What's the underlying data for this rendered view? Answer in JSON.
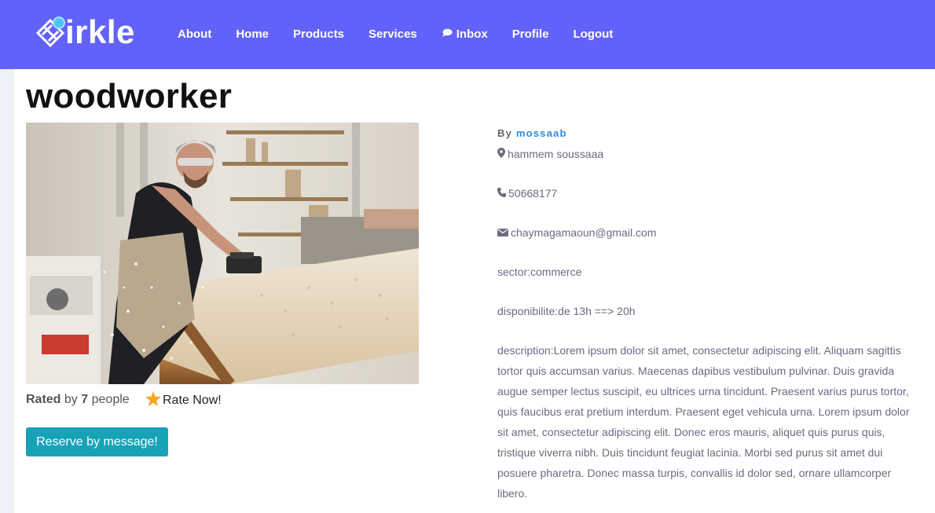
{
  "brand": {
    "name": "irkle"
  },
  "nav": {
    "items": [
      {
        "label": "About",
        "icon": ""
      },
      {
        "label": "Home",
        "icon": ""
      },
      {
        "label": "Products",
        "icon": ""
      },
      {
        "label": "Services",
        "icon": ""
      },
      {
        "label": "Inbox",
        "icon": "chat-bubble-icon"
      },
      {
        "label": "Profile",
        "icon": ""
      },
      {
        "label": "Logout",
        "icon": ""
      }
    ]
  },
  "listing": {
    "title": "woodworker",
    "by_label": "By",
    "author": "mossaab",
    "location": "hammem soussaaa",
    "phone": "50668177",
    "email": "chaymagamaoun@gmail.com",
    "sector": "sector:commerce",
    "availability": "disponibilite:de 13h ==> 20h",
    "description": "description:Lorem ipsum dolor sit amet, consectetur adipiscing elit. Aliquam sagittis tortor quis accumsan varius. Maecenas dapibus vestibulum pulvinar. Duis gravida augue semper lectus suscipit, eu ultrices urna tincidunt. Praesent varius purus tortor, quis faucibus erat pretium interdum. Praesent eget vehicula urna. Lorem ipsum dolor sit amet, consectetur adipiscing elit. Donec eros mauris, aliquet quis purus quis, tristique viverra nibh. Duis tincidunt feugiat lacinia. Morbi sed purus sit amet dui posuere pharetra. Donec massa turpis, convallis id dolor sed, ornare ullamcorper libero."
  },
  "rating": {
    "rated_label": "Rated",
    "by_word": "by",
    "count": "7",
    "people_word": "people",
    "rate_now_label": "Rate Now!"
  },
  "actions": {
    "reserve_label": "Reserve by message!"
  },
  "colors": {
    "navbar": "#6262fa",
    "accent": "#17a2b8",
    "author": "#2a8de0",
    "star": "#f5a623"
  }
}
